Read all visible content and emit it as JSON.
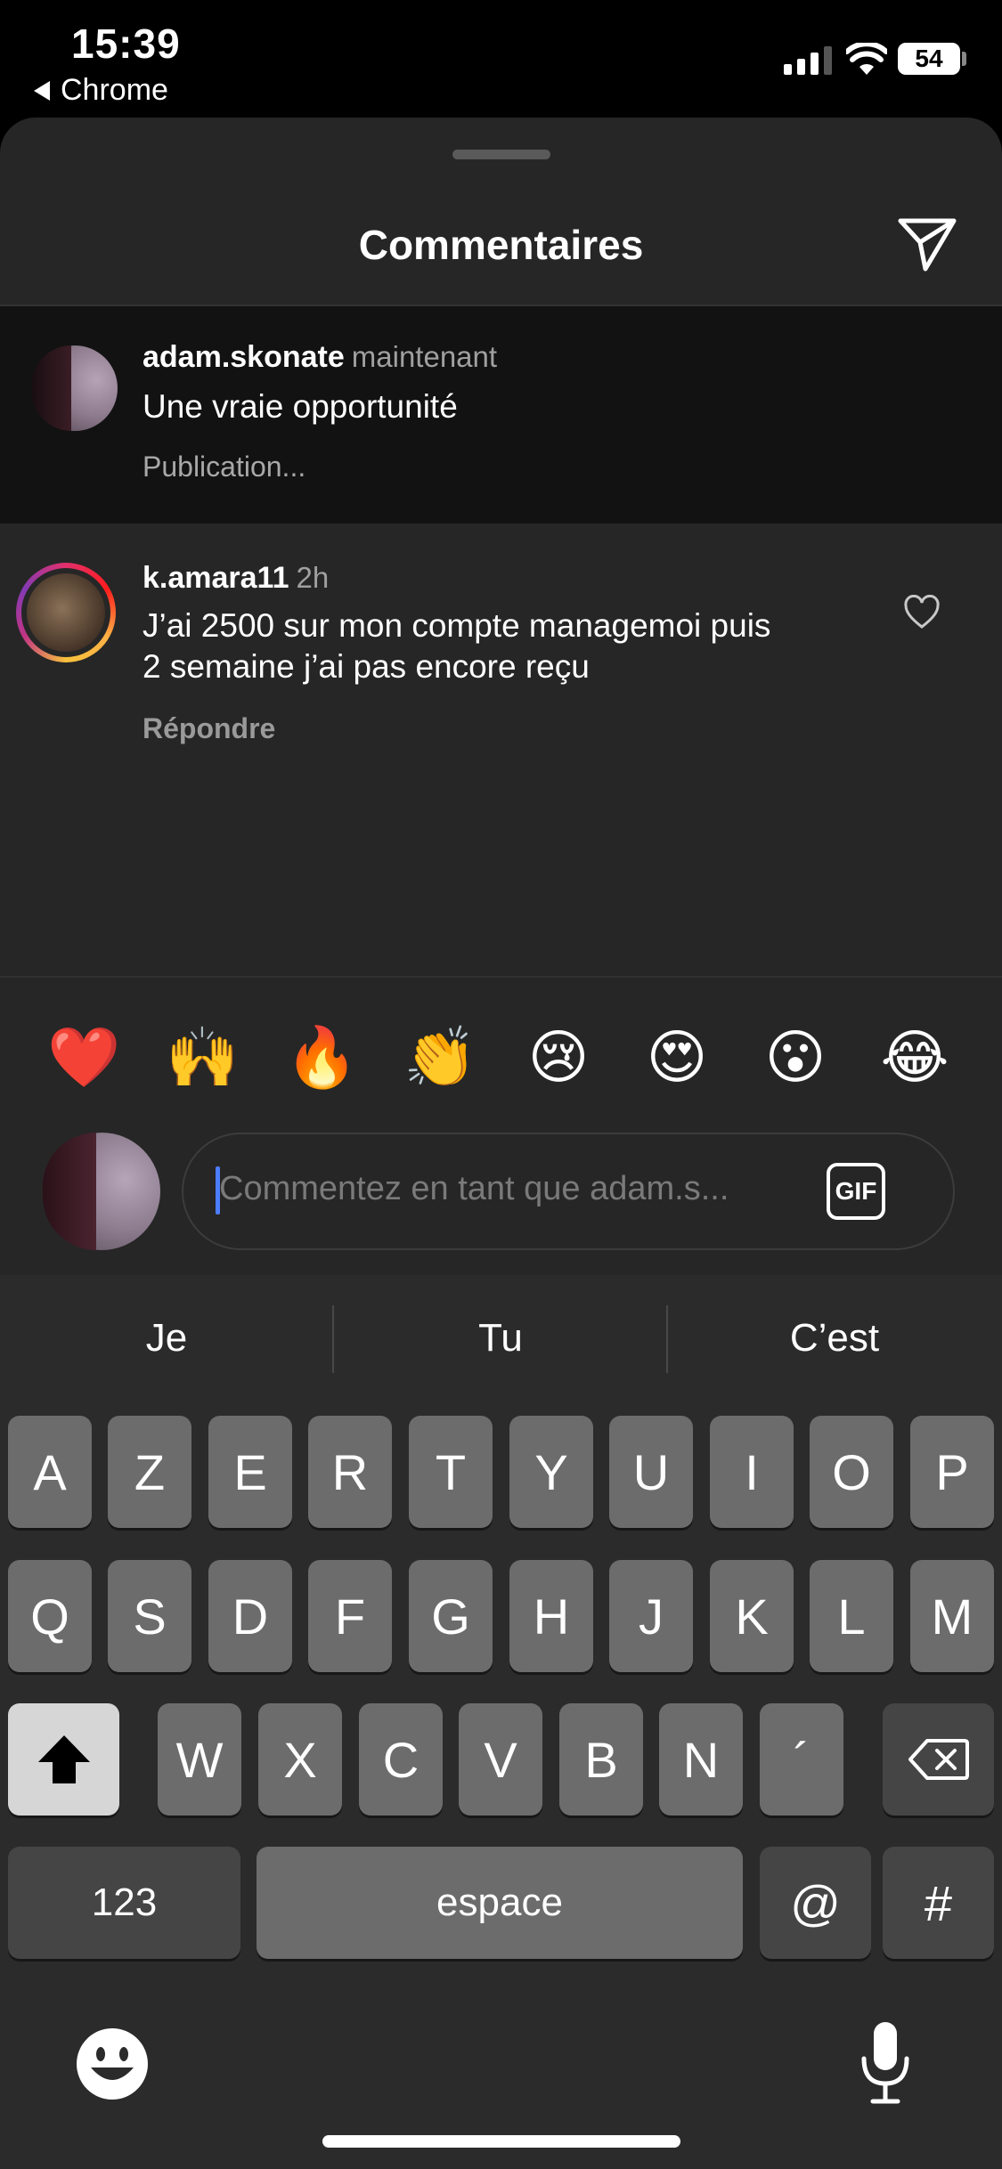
{
  "status_bar": {
    "time": "15:39",
    "back_app": "Chrome",
    "battery": "54"
  },
  "header": {
    "title": "Commentaires"
  },
  "comments": [
    {
      "username": "adam.skonate",
      "time": "maintenant",
      "text": "Une vraie opportunité",
      "meta": "Publication..."
    },
    {
      "username": "k.amara11",
      "time": "2h",
      "text_line1": "J’ai 2500 sur mon compte managemoi puis",
      "text_line2": "2 semaine j’ai pas encore reçu",
      "reply_label": "Répondre"
    }
  ],
  "emoji_reactions": [
    "❤️",
    "🙌",
    "🔥",
    "👏",
    "😢",
    "😍",
    "😮",
    "😂"
  ],
  "composer": {
    "placeholder": "Commentez en tant que adam.s...",
    "gif_label": "GIF"
  },
  "keyboard": {
    "suggestions": [
      "Je",
      "Tu",
      "C’est"
    ],
    "row1": [
      "A",
      "Z",
      "E",
      "R",
      "T",
      "Y",
      "U",
      "I",
      "O",
      "P"
    ],
    "row2": [
      "Q",
      "S",
      "D",
      "F",
      "G",
      "H",
      "J",
      "K",
      "L",
      "M"
    ],
    "row3": [
      "W",
      "X",
      "C",
      "V",
      "B",
      "N",
      "´"
    ],
    "numbers_label": "123",
    "space_label": "espace",
    "at_label": "@",
    "hash_label": "#"
  },
  "icons": {
    "send": "paper-plane-icon",
    "like": "heart-icon",
    "shift": "shift-icon",
    "delete": "backspace-icon",
    "emoji": "emoji-face-icon",
    "dictation": "microphone-icon"
  },
  "colors": {
    "sheet_bg": "#262626",
    "pending_bg": "#121212",
    "caret": "#4c7dff",
    "keyboard_bg": "#2b2b2b"
  }
}
